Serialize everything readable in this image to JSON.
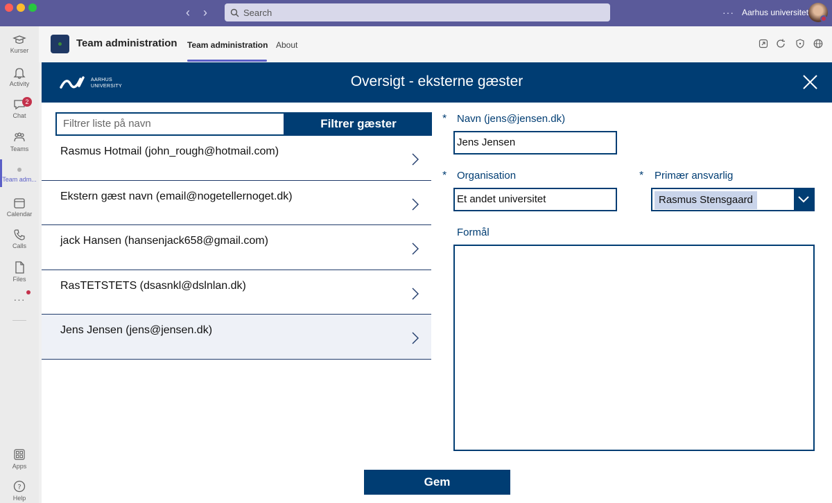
{
  "window": {
    "search_placeholder": "Search",
    "org_name": "Aarhus universitet",
    "more_label": "···"
  },
  "rail": {
    "items": [
      {
        "label": "Kurser",
        "icon": "cap-icon"
      },
      {
        "label": "Activity",
        "icon": "bell-icon"
      },
      {
        "label": "Chat",
        "icon": "chat-icon",
        "badge": "2"
      },
      {
        "label": "Teams",
        "icon": "teams-icon"
      },
      {
        "label": "Team adm...",
        "icon": "app-dot-icon"
      },
      {
        "label": "Calendar",
        "icon": "calendar-icon"
      },
      {
        "label": "Calls",
        "icon": "phone-icon"
      },
      {
        "label": "Files",
        "icon": "file-icon"
      }
    ],
    "more": "···",
    "apps_label": "Apps",
    "help_label": "Help"
  },
  "app_header": {
    "title": "Team administration",
    "tabs": [
      "Team administration",
      "About"
    ],
    "active_tab": "Team administration"
  },
  "banner": {
    "logo_line1": "AARHUS",
    "logo_line2": "UNIVERSITY",
    "title": "Oversigt - eksterne gæster"
  },
  "filter": {
    "placeholder": "Filtrer liste på navn",
    "button_label": "Filtrer gæster"
  },
  "guests": [
    {
      "label": "Rasmus Hotmail (john_rough@hotmail.com)",
      "selected": false
    },
    {
      "label": "Ekstern gæst navn (email@nogetellernoget.dk)",
      "selected": false
    },
    {
      "label": "jack Hansen (hansenjack658@gmail.com)",
      "selected": false
    },
    {
      "label": "RasTETSTETS (dsasnkl@dslnlan.dk)",
      "selected": false
    },
    {
      "label": "Jens Jensen (jens@jensen.dk)",
      "selected": true
    }
  ],
  "form": {
    "required_mark": "*",
    "name_label": "Navn (jens@jensen.dk)",
    "name_value": "Jens Jensen",
    "org_label": "Organisation",
    "org_value": "Et andet universitet",
    "responsible_label": "Primær ansvarlig",
    "responsible_value": "Rasmus Stensgaard",
    "purpose_label": "Formål",
    "purpose_value": "",
    "save_label": "Gem"
  },
  "colors": {
    "brand_navy": "#003d73",
    "titlebar": "#5a5a9a",
    "teams_accent": "#5b5fc7",
    "badge_red": "#c4314b"
  }
}
